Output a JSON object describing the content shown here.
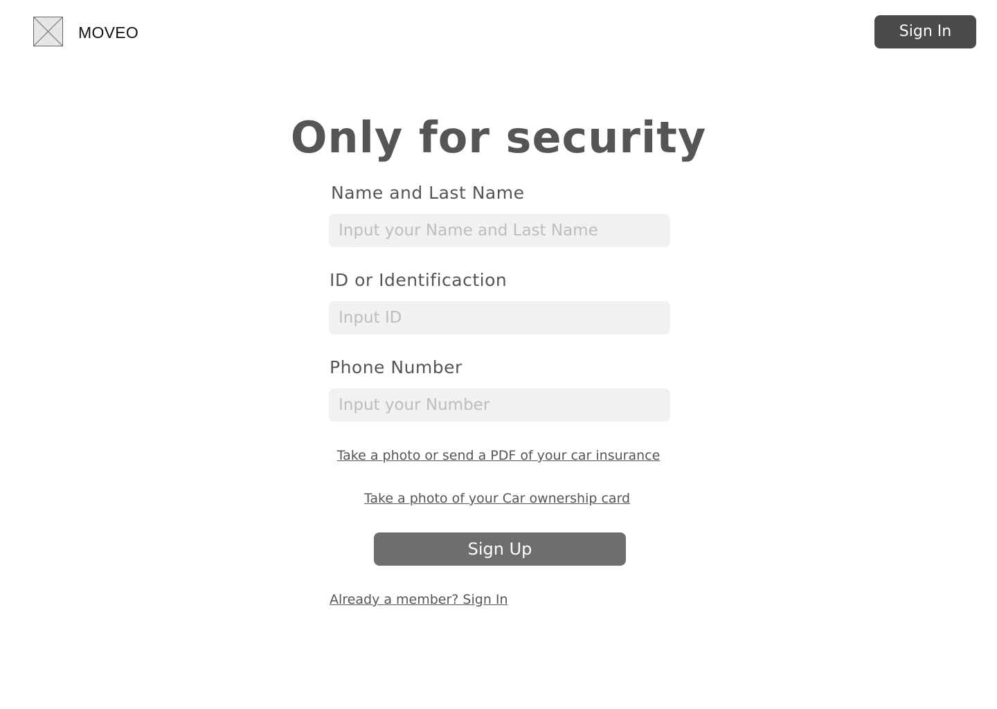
{
  "header": {
    "logo_icon": "image-placeholder-icon",
    "brand": "MOVEO",
    "signin_label": "Sign In"
  },
  "main": {
    "title": "Only for security",
    "fields": [
      {
        "label": "Name and Last Name",
        "placeholder": "Input your Name and Last Name",
        "value": ""
      },
      {
        "label": "ID or Identificaction",
        "placeholder": "Input ID",
        "value": ""
      },
      {
        "label": "Phone Number",
        "placeholder": "Input your Number",
        "value": ""
      }
    ],
    "links": {
      "insurance": "Take a photo or send a PDF of your car insurance",
      "ownership": "Take a photo of your Car ownership card"
    },
    "signup_label": "Sign Up",
    "member_link": "Already a member? Sign In"
  },
  "colors": {
    "primary_button": "#4a4a4a",
    "secondary_button": "#6e6e6e",
    "input_background": "#f1f1f1",
    "text": "#555555"
  }
}
